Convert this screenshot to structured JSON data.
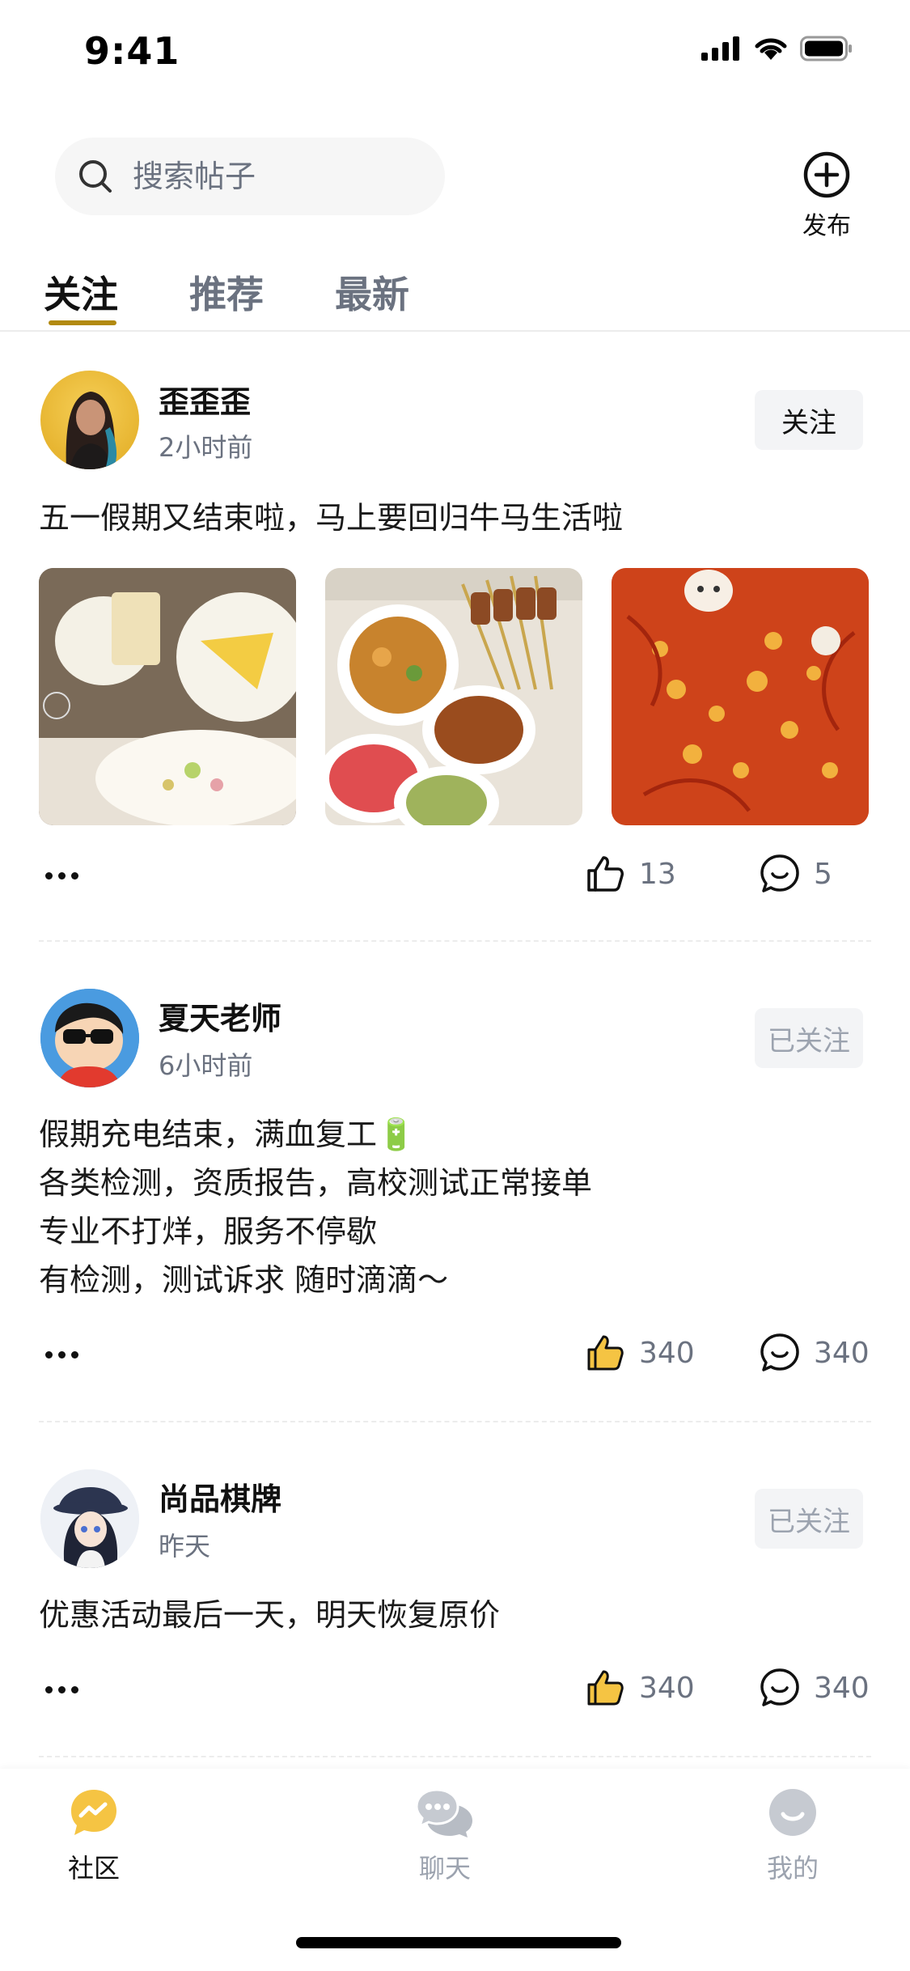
{
  "status_bar": {
    "time": "9:41"
  },
  "header": {
    "search_placeholder": "搜索帖子",
    "publish_label": "发布"
  },
  "tabs": [
    {
      "label": "关注",
      "active": true
    },
    {
      "label": "推荐",
      "active": false
    },
    {
      "label": "最新",
      "active": false
    }
  ],
  "posts": [
    {
      "author": "歪歪歪",
      "time": "2小时前",
      "follow_label": "关注",
      "text": "五一假期又结束啦，马上要回归牛马生活啦",
      "likes": "13",
      "comments": "5",
      "liked": false
    },
    {
      "author": "夏天老师",
      "time": "6小时前",
      "follow_label": "已关注",
      "text": "假期充电结束，满血复工🔋\n各类检测，资质报告，高校测试正常接单\n专业不打烊，服务不停歇\n有检测，测试诉求 随时滴滴～",
      "likes": "340",
      "comments": "340",
      "liked": true
    },
    {
      "author": "尚品棋牌",
      "time": "昨天",
      "follow_label": "已关注",
      "text": "优惠活动最后一天，明天恢复原价",
      "likes": "340",
      "comments": "340",
      "liked": true
    }
  ],
  "tabbar": [
    {
      "label": "社区",
      "icon": "community-icon",
      "active": true
    },
    {
      "label": "聊天",
      "icon": "chat-icon",
      "active": false
    },
    {
      "label": "我的",
      "icon": "profile-icon",
      "active": false
    }
  ],
  "colors": {
    "accent": "#b28a10",
    "like_yellow": "#f5c443",
    "muted": "#6b7280"
  }
}
